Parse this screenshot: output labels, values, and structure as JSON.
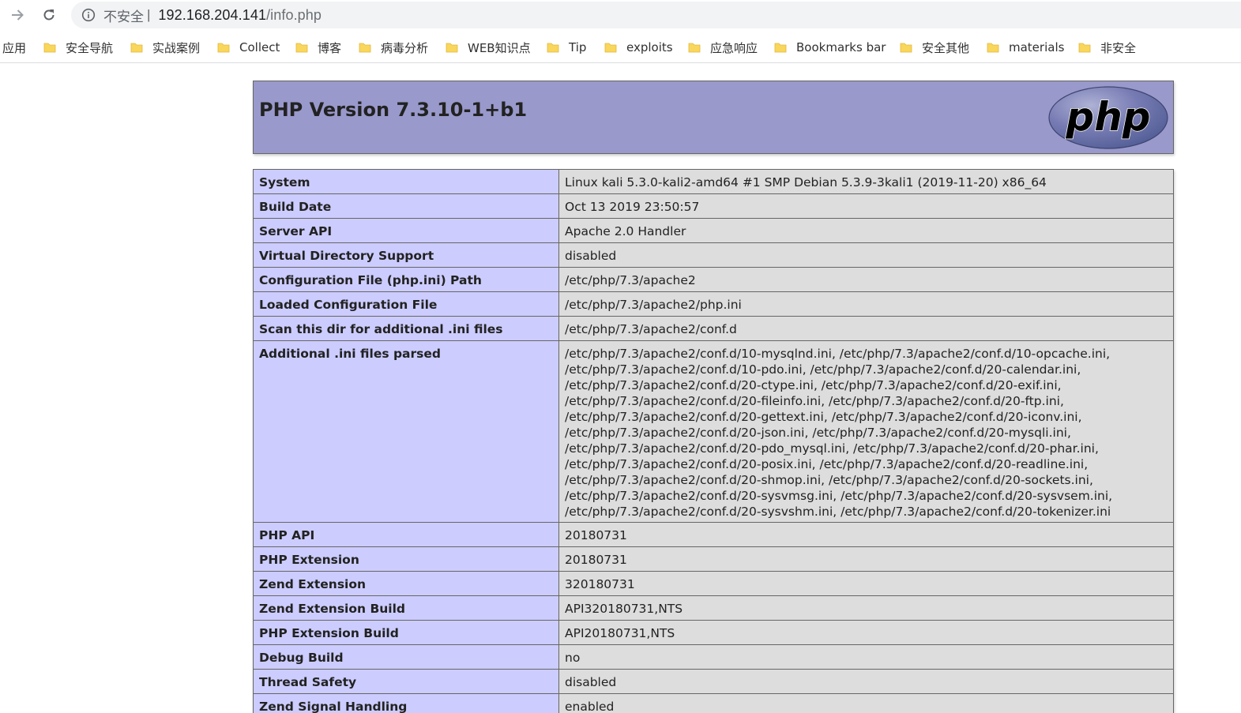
{
  "browser": {
    "security_label": "不安全",
    "separator": "|",
    "url_host": "192.168.204.141",
    "url_path": "/info.php"
  },
  "bookmarks": [
    {
      "label": "应用",
      "icon": "none"
    },
    {
      "label": "安全导航",
      "icon": "folder-icon"
    },
    {
      "label": "实战案例",
      "icon": "folder-icon"
    },
    {
      "label": "Collect",
      "icon": "folder-icon"
    },
    {
      "label": "博客",
      "icon": "folder-icon"
    },
    {
      "label": "病毒分析",
      "icon": "folder-icon"
    },
    {
      "label": "WEB知识点",
      "icon": "folder-icon"
    },
    {
      "label": "Tip",
      "icon": "folder-icon"
    },
    {
      "label": "exploits",
      "icon": "folder-icon"
    },
    {
      "label": "应急响应",
      "icon": "folder-icon"
    },
    {
      "label": "Bookmarks bar",
      "icon": "folder-icon"
    },
    {
      "label": "安全其他",
      "icon": "folder-icon"
    },
    {
      "label": "materials",
      "icon": "folder-icon"
    },
    {
      "label": "非安全",
      "icon": "folder-icon"
    }
  ],
  "phpinfo": {
    "title": "PHP Version 7.3.10-1+b1",
    "logo_text": "php",
    "rows": [
      {
        "key": "System",
        "value": "Linux kali 5.3.0-kali2-amd64 #1 SMP Debian 5.3.9-3kali1 (2019-11-20) x86_64"
      },
      {
        "key": "Build Date",
        "value": "Oct 13 2019 23:50:57"
      },
      {
        "key": "Server API",
        "value": "Apache 2.0 Handler"
      },
      {
        "key": "Virtual Directory Support",
        "value": "disabled"
      },
      {
        "key": "Configuration File (php.ini) Path",
        "value": "/etc/php/7.3/apache2"
      },
      {
        "key": "Loaded Configuration File",
        "value": "/etc/php/7.3/apache2/php.ini"
      },
      {
        "key": "Scan this dir for additional .ini files",
        "value": "/etc/php/7.3/apache2/conf.d"
      }
    ],
    "additional_ini": {
      "key": "Additional .ini files parsed",
      "lines": [
        "/etc/php/7.3/apache2/conf.d/10-mysqlnd.ini, /etc/php/7.3/apache2/conf.d/10-opcache.ini,",
        "/etc/php/7.3/apache2/conf.d/10-pdo.ini, /etc/php/7.3/apache2/conf.d/20-calendar.ini,",
        "/etc/php/7.3/apache2/conf.d/20-ctype.ini, /etc/php/7.3/apache2/conf.d/20-exif.ini,",
        "/etc/php/7.3/apache2/conf.d/20-fileinfo.ini, /etc/php/7.3/apache2/conf.d/20-ftp.ini,",
        "/etc/php/7.3/apache2/conf.d/20-gettext.ini, /etc/php/7.3/apache2/conf.d/20-iconv.ini,",
        "/etc/php/7.3/apache2/conf.d/20-json.ini, /etc/php/7.3/apache2/conf.d/20-mysqli.ini,",
        "/etc/php/7.3/apache2/conf.d/20-pdo_mysql.ini, /etc/php/7.3/apache2/conf.d/20-phar.ini,",
        "/etc/php/7.3/apache2/conf.d/20-posix.ini, /etc/php/7.3/apache2/conf.d/20-readline.ini,",
        "/etc/php/7.3/apache2/conf.d/20-shmop.ini, /etc/php/7.3/apache2/conf.d/20-sockets.ini,",
        "/etc/php/7.3/apache2/conf.d/20-sysvmsg.ini, /etc/php/7.3/apache2/conf.d/20-sysvsem.ini,",
        "/etc/php/7.3/apache2/conf.d/20-sysvshm.ini, /etc/php/7.3/apache2/conf.d/20-tokenizer.ini"
      ]
    },
    "rows_after": [
      {
        "key": "PHP API",
        "value": "20180731"
      },
      {
        "key": "PHP Extension",
        "value": "20180731"
      },
      {
        "key": "Zend Extension",
        "value": "320180731"
      },
      {
        "key": "Zend Extension Build",
        "value": "API320180731,NTS"
      },
      {
        "key": "PHP Extension Build",
        "value": "API20180731,NTS"
      },
      {
        "key": "Debug Build",
        "value": "no"
      },
      {
        "key": "Thread Safety",
        "value": "disabled"
      },
      {
        "key": "Zend Signal Handling",
        "value": "enabled"
      }
    ]
  },
  "colors": {
    "header_bg": "#9999cc",
    "key_cell_bg": "#ccccff",
    "value_cell_bg": "#dddddd",
    "folder_icon": "#f9d65c"
  }
}
